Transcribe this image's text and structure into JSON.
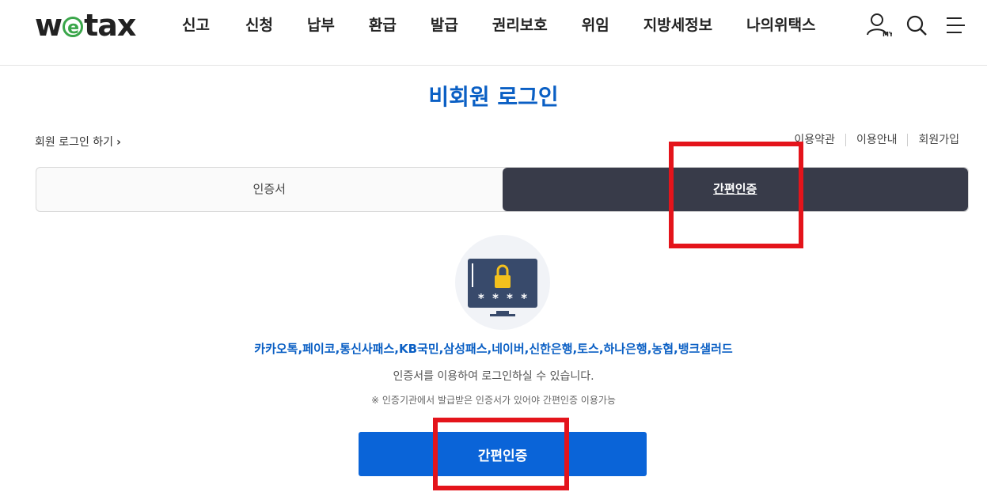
{
  "header": {
    "logo": {
      "pre": "w",
      "mid": "e",
      "post": "tax"
    },
    "nav": [
      "신고",
      "신청",
      "납부",
      "환급",
      "발급",
      "권리보호",
      "위임",
      "지방세정보",
      "나의위택스"
    ],
    "my_badge": "MY"
  },
  "page_title": "비회원 로그인",
  "member_login_link": "회원 로그인 하기",
  "top_links": [
    "이용약관",
    "이용안내",
    "회원가입"
  ],
  "tabs": [
    {
      "label": "인증서",
      "active": false
    },
    {
      "label": "간편인증",
      "active": true
    }
  ],
  "illustration": {
    "password_mask": "* * * *"
  },
  "providers_text": "카카오톡,페이코,통신사패스,KB국민,삼성패스,네이버,신한은행,토스,하나은행,농협,뱅크샐러드",
  "description": "인증서를 이용하여 로그인하실 수 있습니다.",
  "note": "※ 인증기관에서 발급받은 인증서가 있어야 간편인증 이용가능",
  "main_button_label": "간편인증",
  "colors": {
    "accent": "#0a64d8",
    "title": "#0a5fc4",
    "tab_active": "#383b49",
    "highlight": "#e4141b",
    "logo_green": "#3aa64a"
  }
}
